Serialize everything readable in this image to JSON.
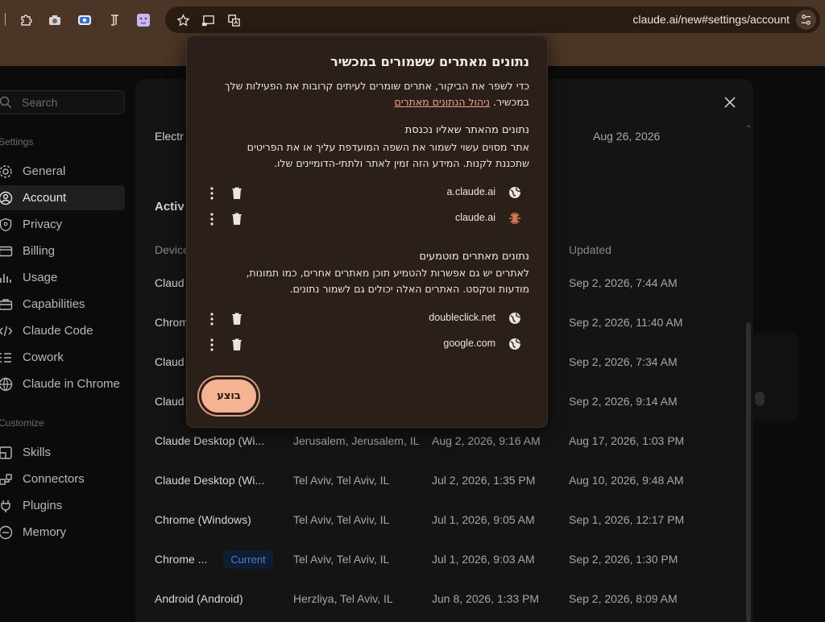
{
  "browser": {
    "url": "claude.ai/new#settings/account",
    "extensions": [
      "puzzle-icon",
      "camera-icon",
      "screen-capture-icon",
      "text-format-icon",
      "smiley-icon"
    ],
    "omnibox_icons": [
      "star-icon",
      "cast-icon",
      "translate-icon"
    ]
  },
  "sidebar": {
    "search_placeholder": "Search",
    "settings_label": "Settings",
    "customize_label": "Customize",
    "settings_items": [
      {
        "label": "General",
        "icon": "gear-icon"
      },
      {
        "label": "Account",
        "icon": "user-icon",
        "active": true
      },
      {
        "label": "Privacy",
        "icon": "shield-icon"
      },
      {
        "label": "Billing",
        "icon": "card-icon"
      },
      {
        "label": "Usage",
        "icon": "chart-icon"
      },
      {
        "label": "Capabilities",
        "icon": "briefcase-icon"
      },
      {
        "label": "Claude Code",
        "icon": "code-icon"
      },
      {
        "label": "Cowork",
        "icon": "list-icon"
      },
      {
        "label": "Claude in Chrome",
        "icon": "globe-icon"
      }
    ],
    "customize_items": [
      {
        "label": "Skills",
        "icon": "skills-icon"
      },
      {
        "label": "Connectors",
        "icon": "connectors-icon"
      },
      {
        "label": "Plugins",
        "icon": "plug-icon"
      },
      {
        "label": "Memory",
        "icon": "memory-icon"
      }
    ]
  },
  "content": {
    "top_row": {
      "device": "Electr",
      "updated": "Aug 26, 2026"
    },
    "section_heading": "Activ",
    "columns": {
      "device": "Device",
      "updated": "Updated"
    },
    "current_badge": "Current",
    "sessions": [
      {
        "device": "Claud",
        "location": "",
        "created": "",
        "updated": "Sep 2, 2026, 7:44 AM"
      },
      {
        "device": "Chrom",
        "location": "",
        "created": "",
        "updated": "Sep 2, 2026, 11:40 AM"
      },
      {
        "device": "Claud",
        "location": "",
        "created": "",
        "updated": "Sep 2, 2026, 7:34 AM"
      },
      {
        "device": "Claud",
        "location": "",
        "created": "",
        "updated": "Sep 2, 2026, 9:14 AM"
      },
      {
        "device": "Claude Desktop (Wi...",
        "location": "Jerusalem, Jerusalem, IL",
        "created": "Aug 2, 2026, 9:16 AM",
        "updated": "Aug 17, 2026, 1:03 PM"
      },
      {
        "device": "Claude Desktop (Wi...",
        "location": "Tel Aviv, Tel Aviv, IL",
        "created": "Jul 2, 2026, 1:35 PM",
        "updated": "Aug 10, 2026, 9:48 AM"
      },
      {
        "device": "Chrome (Windows)",
        "location": "Tel Aviv, Tel Aviv, IL",
        "created": "Jul 1, 2026, 9:05 AM",
        "updated": "Sep 1, 2026, 12:17 PM"
      },
      {
        "device": "Chrome ...",
        "location": "Tel Aviv, Tel Aviv, IL",
        "created": "Jul 1, 2026, 9:03 AM",
        "updated": "Sep 2, 2026, 1:30 PM"
      },
      {
        "device": "Android (Android)",
        "location": "Herzliya, Tel Aviv, IL",
        "created": "Jun 8, 2026, 1:33 PM",
        "updated": "Sep 2, 2026, 8:09 AM"
      }
    ]
  },
  "dialog": {
    "title": "נתונים מאתרים ששמורים במכשיר",
    "intro_line1": "כדי לשפר את הביקור, אתרים שומרים לעיתים קרובות את הפעילות שלך",
    "intro_line2_prefix": "במכשיר.",
    "intro_link": "ניהול הנתונים מאתרים",
    "visited_heading": "נתונים מהאתר שאליו נכנסת",
    "visited_line1": "אתר מסוים עשוי לשמור את השפה המועדפת עליך או את הפריטים",
    "visited_line2": "שתכננת לקנות. המידע הזה זמין לאתר ולתתי-הדומיינים שלו.",
    "visited_sites": [
      {
        "name": "a.claude.ai",
        "icon": "globe-icon"
      },
      {
        "name": "claude.ai",
        "icon": "claude-logo-icon"
      }
    ],
    "embedded_heading": "נתונים מאתרים מוטמעים",
    "embedded_line1": "לאתרים יש גם אפשרות להטמיע תוכן מאתרים אחרים, כמו תמונות,",
    "embedded_line2": "מודעות וטקסט. האתרים האלה יכולים גם לשמור נתונים.",
    "embedded_sites": [
      {
        "name": "doubleclick.net",
        "icon": "globe-icon"
      },
      {
        "name": "google.com",
        "icon": "globe-icon"
      }
    ],
    "done_label": "בוצע"
  }
}
